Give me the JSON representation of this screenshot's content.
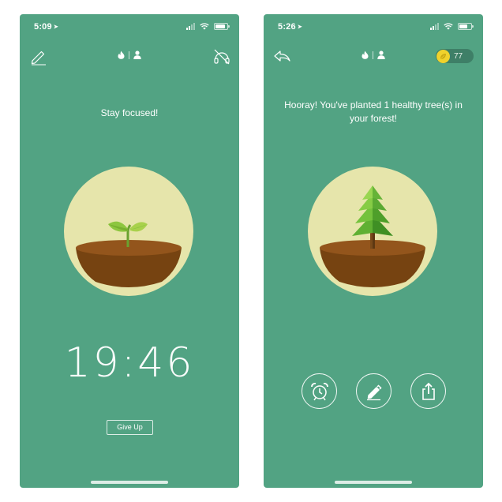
{
  "colors": {
    "background": "#52a383",
    "circle": "#e6e5ab",
    "soil_dark": "#764311",
    "soil_top": "#93551c",
    "leaf": "#8dc63f",
    "tree_green": "#5fb032",
    "coin": "#f0d22c"
  },
  "focus_screen": {
    "status": {
      "time": "5:09"
    },
    "toolbar": {
      "left_icon": "pencil-icon",
      "center_icons": [
        "flame-icon",
        "person-icon"
      ],
      "right_icon": "sound-off-icon"
    },
    "message": "Stay focused!",
    "plant": "sprout",
    "timer": "19:46",
    "give_up_label": "Give Up"
  },
  "success_screen": {
    "status": {
      "time": "5:26"
    },
    "toolbar": {
      "left_icon": "back-arrow-icon",
      "center_icons": [
        "flame-icon",
        "person-icon"
      ],
      "coins": "77"
    },
    "message": "Hooray! You've planted 1 healthy tree(s) in your forest!",
    "plant": "pine-tree",
    "actions": [
      "alarm-clock-icon",
      "pencil-icon",
      "share-icon"
    ]
  }
}
